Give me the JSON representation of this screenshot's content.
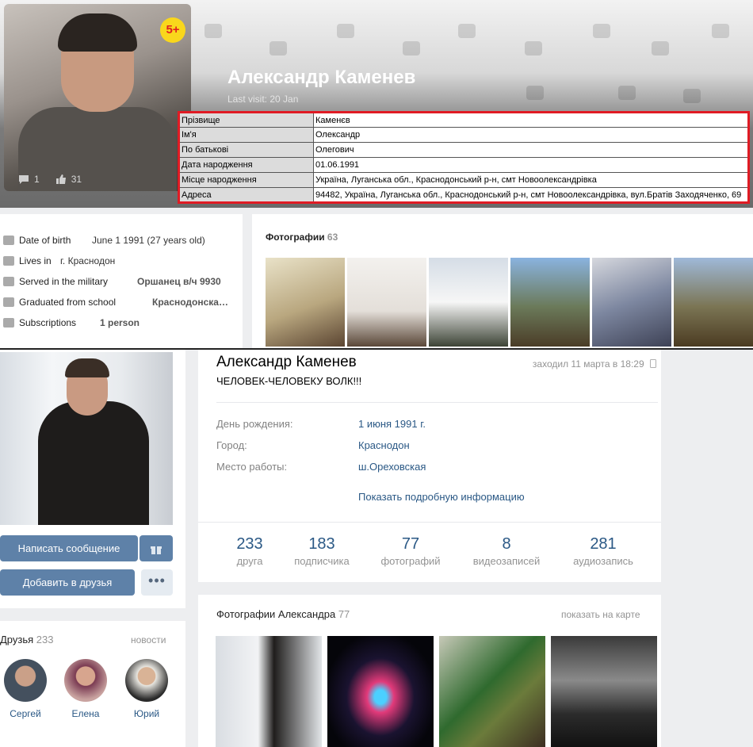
{
  "top_profile": {
    "badge": "5+",
    "name": "Александр Каменев",
    "last_visit": "Last visit: 20 Jan",
    "avatar_comments": "1",
    "avatar_likes": "31",
    "registry": [
      {
        "key": "Прізвище",
        "value": "Каменєв"
      },
      {
        "key": "Ім'я",
        "value": "Олександр"
      },
      {
        "key": "По батькові",
        "value": "Олегович"
      },
      {
        "key": "Дата народження",
        "value": "01.06.1991"
      },
      {
        "key": "Місце народження",
        "value": "Україна, Луганська обл., Краснодонський р-н, смт Новоолександрівка"
      },
      {
        "key": "Адреса",
        "value": "94482, Україна, Луганська обл., Краснодонський р-н, смт Новоолександрівка, вул.Братів Заходяченко, 69"
      }
    ],
    "info": [
      {
        "label": "Date of birth",
        "value": "June 1 1991 (27 years old)",
        "icon": "calendar-icon"
      },
      {
        "label": "Lives in",
        "value": "г. Краснодон",
        "icon": "home-icon"
      },
      {
        "label": "Served in the military",
        "value": "Оршанец в/ч 9930",
        "icon": "military-icon"
      },
      {
        "label": "Graduated from school",
        "value": "Краснодонска…",
        "icon": "school-icon"
      },
      {
        "label": "Subscriptions",
        "value": "1 person",
        "icon": "rss-icon"
      }
    ],
    "photos_title": "Фотографии",
    "photos_count": "63"
  },
  "bottom_profile": {
    "name": "Александр Каменев",
    "status": "ЧЕЛОВЕК-ЧЕЛОВЕКУ ВОЛК!!!",
    "last_visit": "заходил 11 марта в 18:29",
    "send_message": "Написать сообщение",
    "add_friend": "Добавить в друзья",
    "more": "•••",
    "details": [
      {
        "label": "День рождения:",
        "value": "1 июня 1991 г."
      },
      {
        "label": "Город:",
        "value": "Краснодон"
      },
      {
        "label": "Место работы:",
        "value": "ш.Ореховская"
      }
    ],
    "more_info": "Показать подробную информацию",
    "stats": [
      {
        "num": "233",
        "label": "друга"
      },
      {
        "num": "183",
        "label": "подписчика"
      },
      {
        "num": "77",
        "label": "фотографий"
      },
      {
        "num": "8",
        "label": "видеозаписей"
      },
      {
        "num": "281",
        "label": "аудиозапись"
      }
    ],
    "friends_title": "Друзья",
    "friends_count": "233",
    "friends_news": "новости",
    "friends": [
      "Сергей",
      "Елена",
      "Юрий"
    ],
    "photos_title": "Фотографии Александра",
    "photos_count": "77",
    "photos_map": "показать на карте"
  },
  "colors": {
    "vk_blue": "#5e81a8",
    "link": "#2a5885",
    "highlight_border": "#e01b24",
    "badge": "#f9d71c"
  }
}
